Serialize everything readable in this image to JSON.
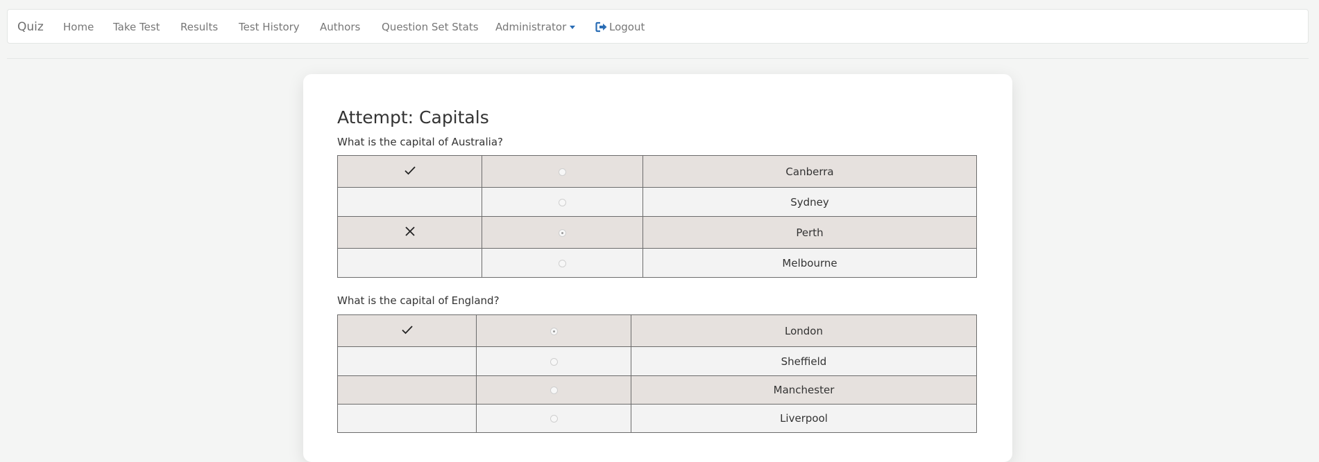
{
  "nav": {
    "brand": "Quiz",
    "links": [
      "Home",
      "Take Test",
      "Results",
      "Test History",
      "Authors",
      "Question Set Stats"
    ],
    "admin_label": "Administrator",
    "logout_label": "Logout"
  },
  "attempt": {
    "title": "Attempt: Capitals",
    "questions": [
      {
        "text": "What is the capital of Australia?",
        "answers": [
          {
            "mark": "check-icon",
            "selected": false,
            "label": "Canberra"
          },
          {
            "mark": "",
            "selected": false,
            "label": "Sydney"
          },
          {
            "mark": "cross-icon",
            "selected": true,
            "label": "Perth"
          },
          {
            "mark": "",
            "selected": false,
            "label": "Melbourne"
          }
        ]
      },
      {
        "text": "What is the capital of England?",
        "answers": [
          {
            "mark": "check-icon",
            "selected": true,
            "label": "London"
          },
          {
            "mark": "",
            "selected": false,
            "label": "Sheffield"
          },
          {
            "mark": "",
            "selected": false,
            "label": "Manchester"
          },
          {
            "mark": "",
            "selected": false,
            "label": "Liverpool"
          }
        ]
      }
    ]
  },
  "colors": {
    "link_accent": "#2a6db5",
    "row_shaded": "#e6e1de",
    "row_light": "#f3f3f3"
  }
}
